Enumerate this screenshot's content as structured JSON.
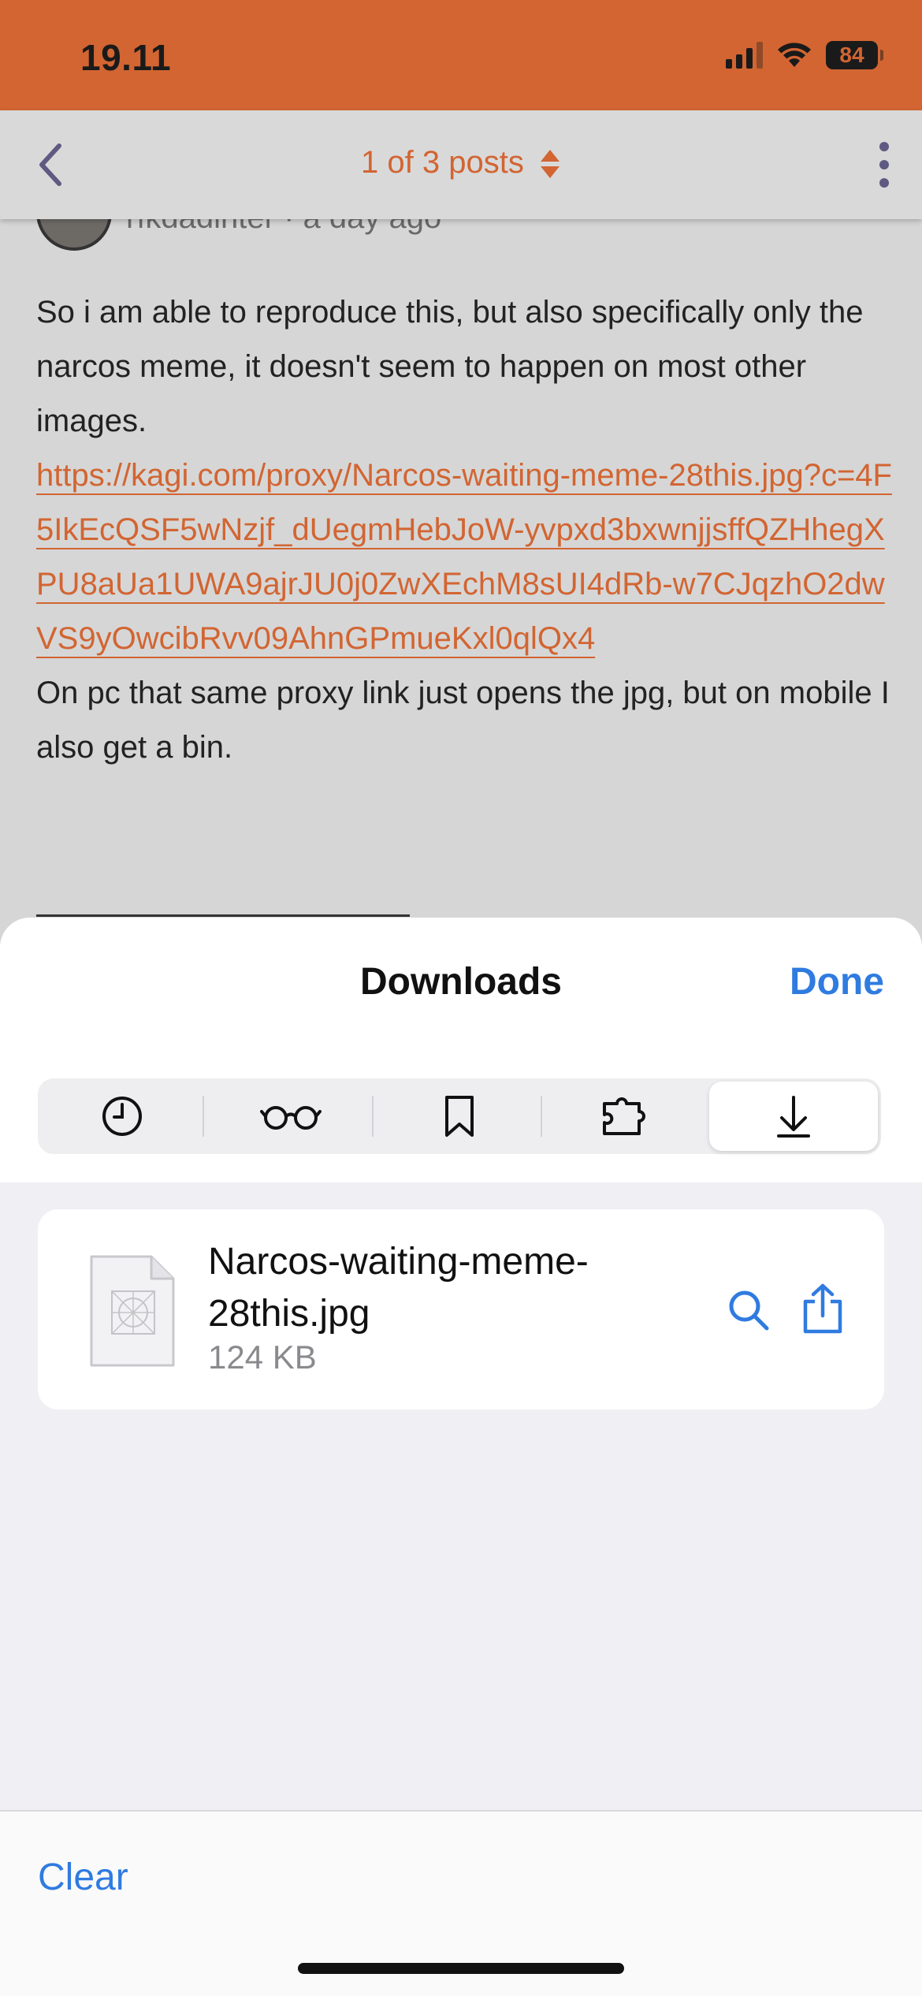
{
  "status_bar": {
    "time": "19.11",
    "battery": "84",
    "color": "#d26532"
  },
  "header": {
    "title": "1 of 3 posts",
    "back_icon": "chevron-left-icon",
    "more_icon": "vertical-ellipsis-icon"
  },
  "post": {
    "author_peek": "rfkdadlnter · a day ago",
    "body_text": "So i am able to reproduce this, but also specifically only the narcos meme, it doesn't seem to happen on most other images.",
    "link": "https://kagi.com/proxy/Narcos-waiting-meme-28this.jpg?c=4F5IkEcQSF5wNzjf_dUegmHebJoW-yvpxd3bxwnjjsffQZHhegXPU8aUa1UWA9ajrJU0j0ZwXEchM8sUI4dRb-w7CJqzhO2dwVS9yOwcibRvv09AhnGPmueKxl0qlQx4",
    "after_text": "On pc that same proxy link just opens the jpg, but on mobile I also get a bin."
  },
  "sheet": {
    "title": "Downloads",
    "done_label": "Done",
    "tabs": [
      {
        "icon": "clock-icon",
        "name": "history"
      },
      {
        "icon": "glasses-icon",
        "name": "reading-list"
      },
      {
        "icon": "bookmark-icon",
        "name": "bookmarks"
      },
      {
        "icon": "puzzle-icon",
        "name": "extensions"
      },
      {
        "icon": "download-icon",
        "name": "downloads",
        "active": true
      }
    ],
    "file": {
      "name": "Narcos-waiting-meme-28this.jpg",
      "size": "124 KB",
      "search_icon": "magnifier-icon",
      "share_icon": "share-icon"
    },
    "clear_label": "Clear",
    "accent": "#2f7be0"
  }
}
